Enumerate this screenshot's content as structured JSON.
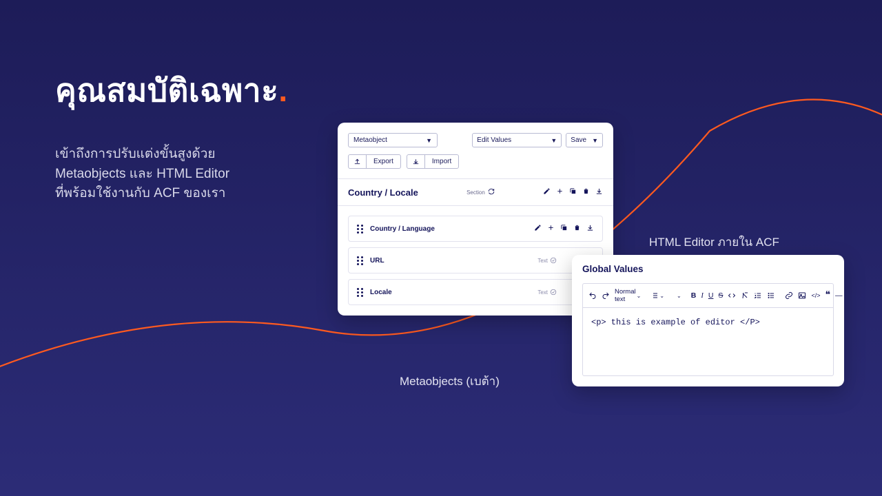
{
  "headline": "คุณสมบัติเฉพาะ",
  "subtitle_l1": "เข้าถึงการปรับแต่งขั้นสูงด้วย",
  "subtitle_l2": "Metaobjects และ HTML Editor",
  "subtitle_l3": "ที่พร้อมใช้งานกับ ACF ของเรา",
  "labels": {
    "metaobjects": "Metaobjects (เบต้า)",
    "editor": "HTML Editor ภายใน ACF"
  },
  "meta_panel": {
    "type_select": "Metaobject",
    "edit_values": "Edit Values",
    "save": "Save",
    "export": "Export",
    "import": "Import",
    "section_title": "Country / Locale",
    "section_label": "Section",
    "fields": [
      {
        "name": "Country / Language",
        "type": "",
        "full_icons": true
      },
      {
        "name": "URL",
        "type": "Text",
        "full_icons": false
      },
      {
        "name": "Locale",
        "type": "Text",
        "full_icons": false
      }
    ]
  },
  "editor_panel": {
    "title": "Global Values",
    "text_style": "Normal text",
    "content": "<p> this is example of editor </P>"
  }
}
